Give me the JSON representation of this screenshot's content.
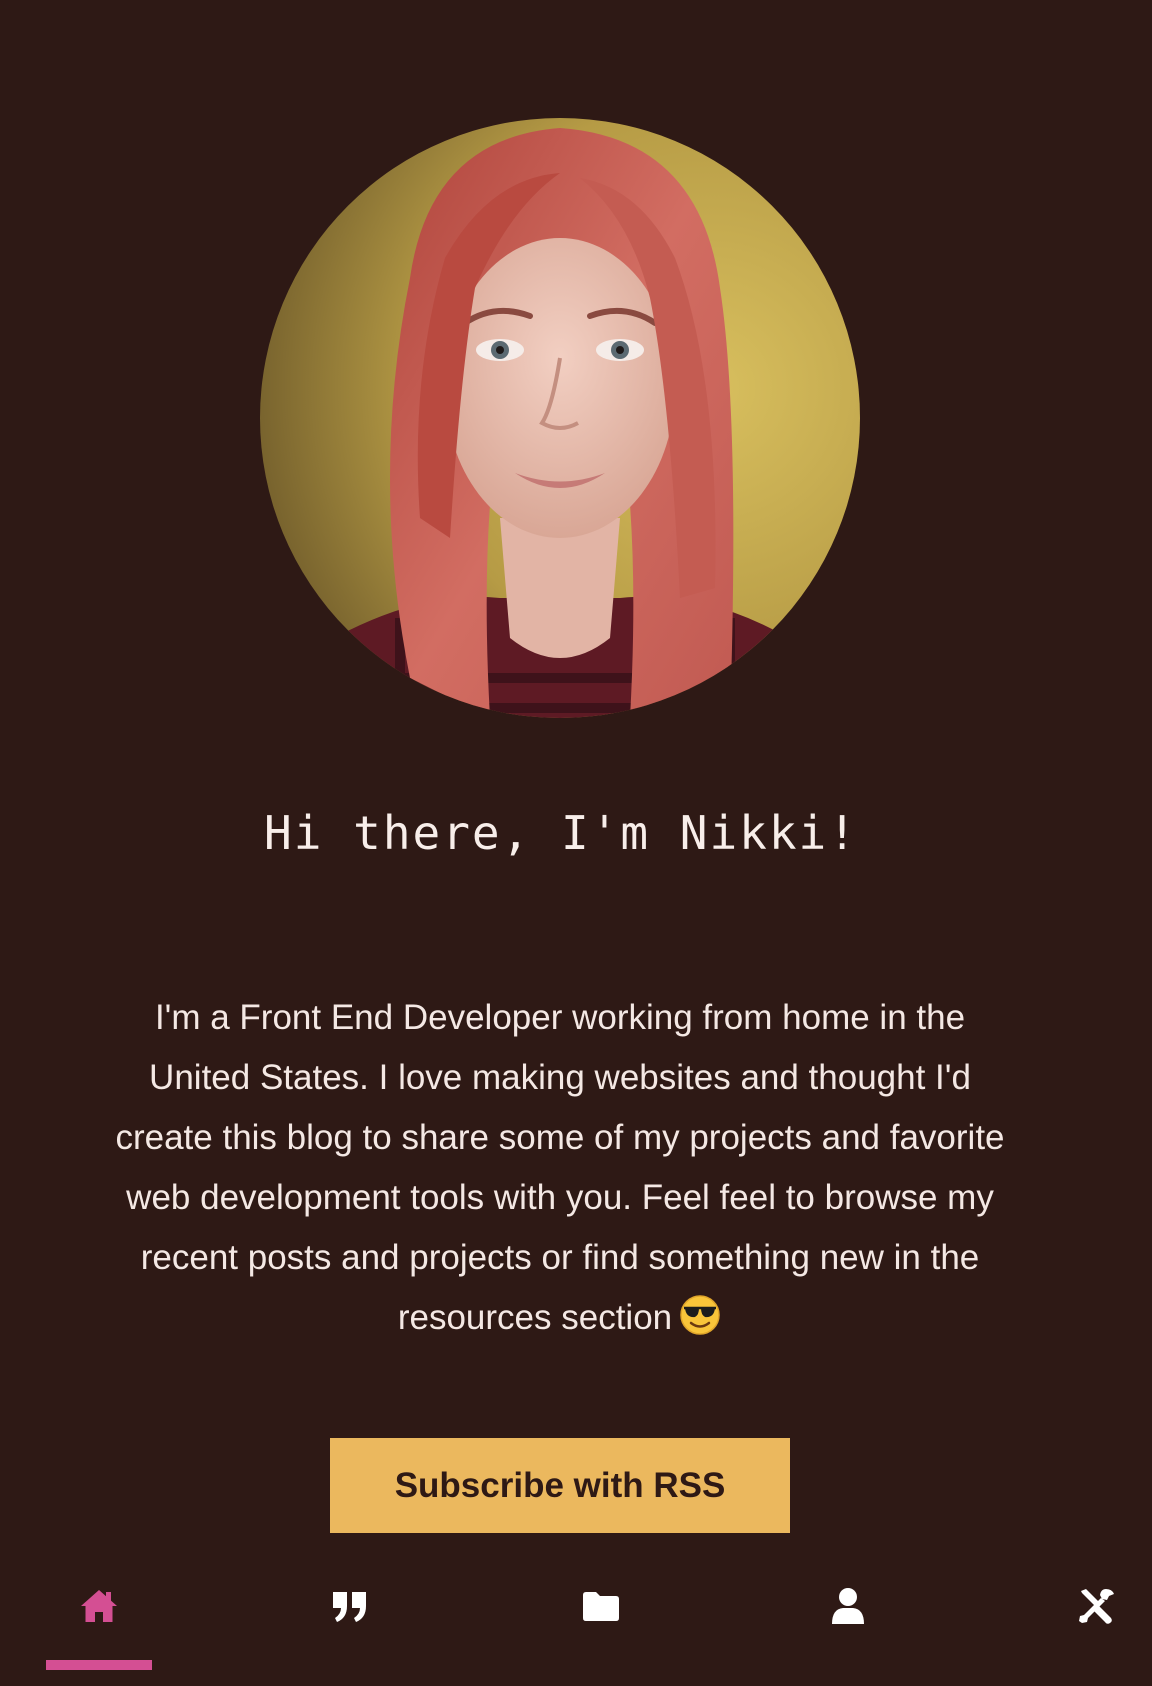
{
  "colors": {
    "background": "#2e1915",
    "text": "#f6ece8",
    "button_bg": "#ebb85e",
    "button_text": "#2e1915",
    "nav_active": "#d44f93",
    "nav_icon": "#ffffff"
  },
  "profile": {
    "avatar_icon": "profile-photo"
  },
  "intro": {
    "heading": "Hi there, I'm Nikki!",
    "bio": "I'm a Front End Developer working from home in the United States. I love making websites and thought I'd create this blog to share some of my projects and favorite web development tools with you. Feel feel to browse my recent posts and projects or find something new in the resources section",
    "emoji_icon": "sunglasses-smiley-icon"
  },
  "subscribe": {
    "label": "Subscribe with RSS"
  },
  "nav": {
    "items": [
      {
        "icon": "home-icon",
        "active": true
      },
      {
        "icon": "quote-icon",
        "active": false
      },
      {
        "icon": "folder-icon",
        "active": false
      },
      {
        "icon": "user-icon",
        "active": false
      },
      {
        "icon": "tools-icon",
        "active": false
      }
    ]
  }
}
